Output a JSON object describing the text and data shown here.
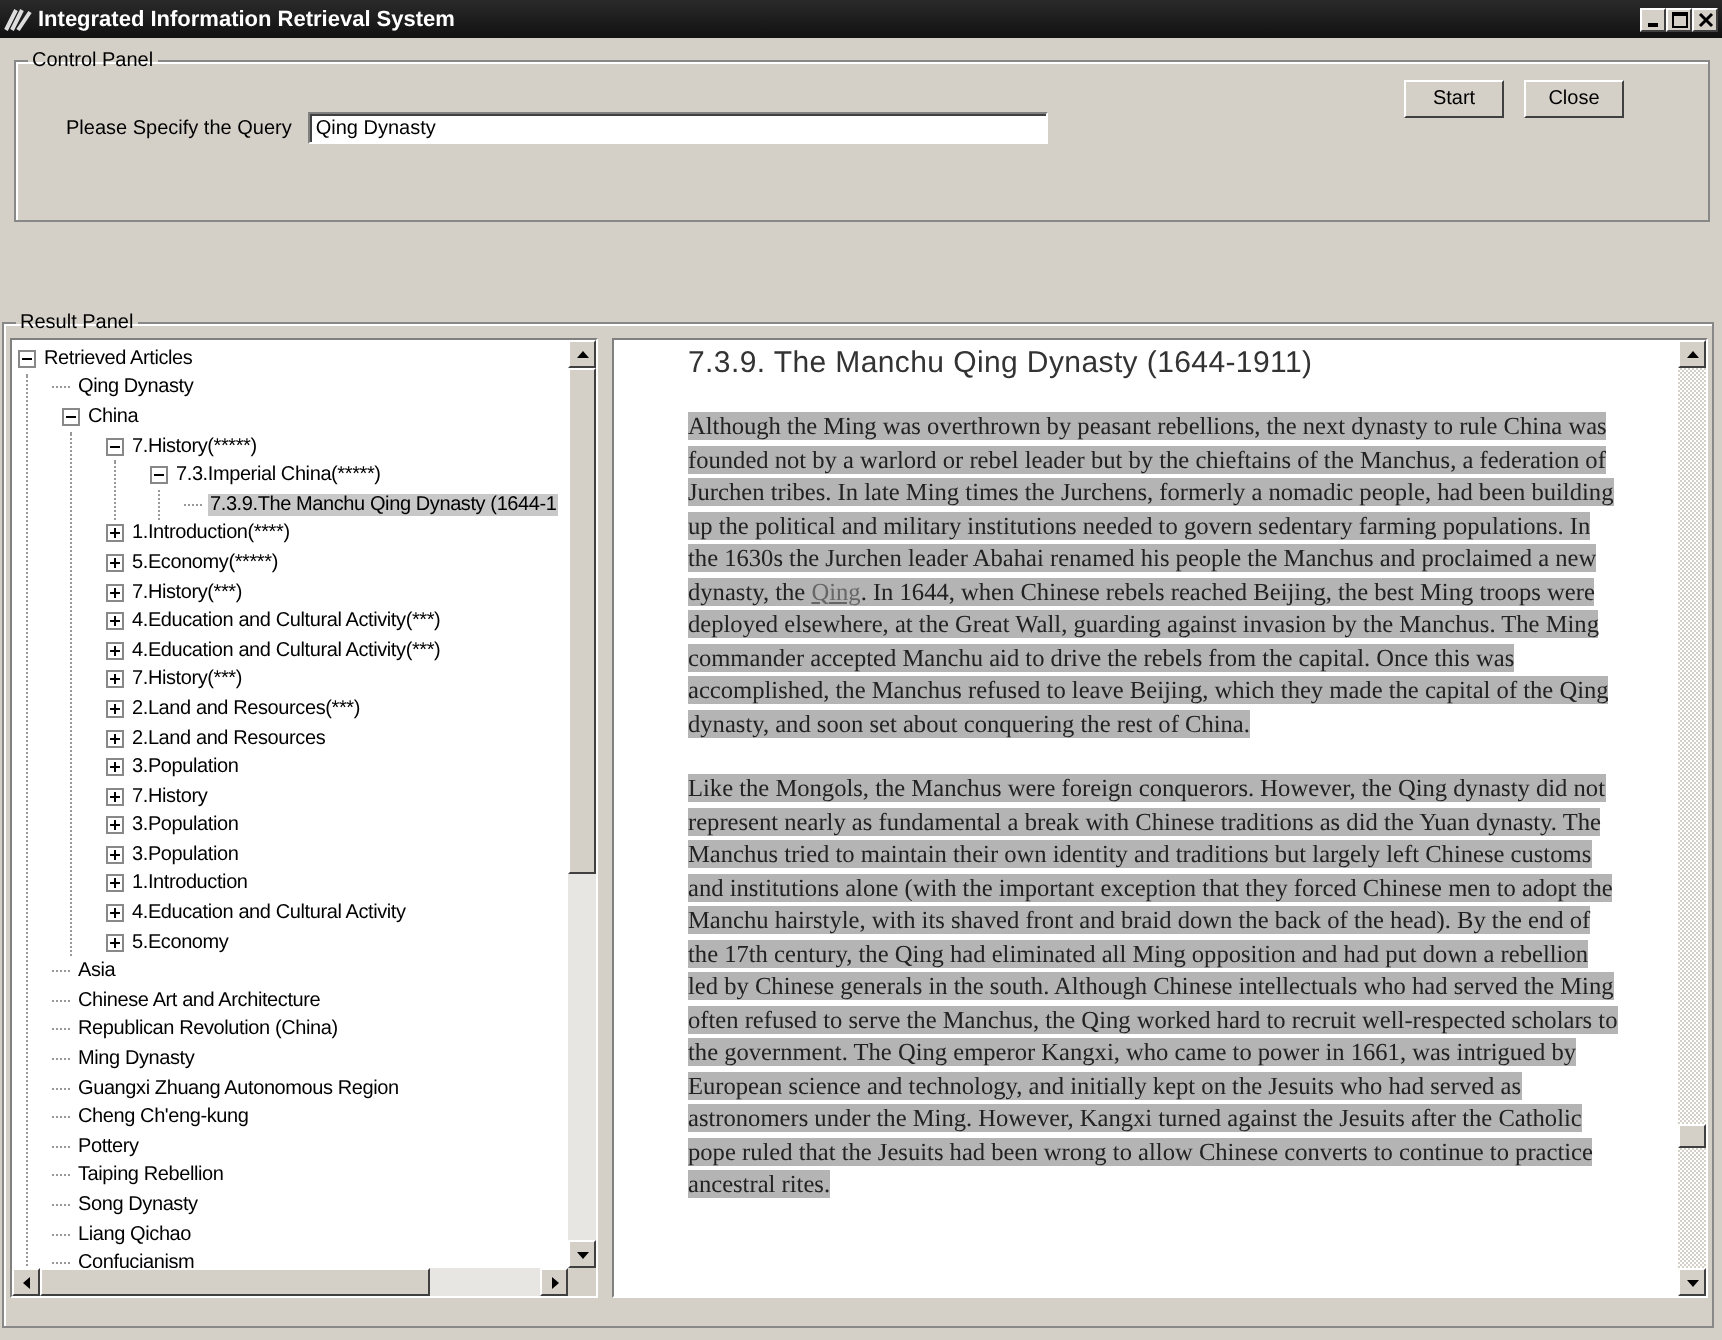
{
  "window": {
    "title": "Integrated Information Retrieval System"
  },
  "control_panel": {
    "title": "Control Panel",
    "query_label": "Please Specify the Query",
    "query_value": "Qing Dynasty",
    "buttons": [
      "Start",
      "Close"
    ]
  },
  "result_panel": {
    "title": "Result Panel",
    "tree": [
      {
        "kind": "node",
        "label": "Retrieved Articles",
        "expanded": true,
        "selected": false,
        "children": [
          {
            "kind": "leaf",
            "label": "Qing Dynasty",
            "selected": false
          },
          {
            "kind": "node",
            "label": "China",
            "expanded": true,
            "selected": false,
            "children": [
              {
                "kind": "node",
                "label": "7.History(*****)",
                "expanded": true,
                "selected": false,
                "children": [
                  {
                    "kind": "node",
                    "label": "7.3.Imperial China(*****)",
                    "expanded": true,
                    "selected": false,
                    "children": [
                      {
                        "kind": "leaf",
                        "label": "7.3.9.The Manchu Qing Dynasty (1644-1",
                        "selected": true
                      }
                    ]
                  }
                ]
              },
              {
                "kind": "node",
                "label": "1.Introduction(****)",
                "expanded": false,
                "selected": false
              },
              {
                "kind": "node",
                "label": "5.Economy(*****)",
                "expanded": false,
                "selected": false
              },
              {
                "kind": "node",
                "label": "7.History(***)",
                "expanded": false,
                "selected": false
              },
              {
                "kind": "node",
                "label": "4.Education and Cultural Activity(***)",
                "expanded": false,
                "selected": false
              },
              {
                "kind": "node",
                "label": "4.Education and Cultural Activity(***)",
                "expanded": false,
                "selected": false
              },
              {
                "kind": "node",
                "label": "7.History(***)",
                "expanded": false,
                "selected": false
              },
              {
                "kind": "node",
                "label": "2.Land and Resources(***)",
                "expanded": false,
                "selected": false
              },
              {
                "kind": "node",
                "label": "2.Land and Resources",
                "expanded": false,
                "selected": false
              },
              {
                "kind": "node",
                "label": "3.Population",
                "expanded": false,
                "selected": false
              },
              {
                "kind": "node",
                "label": "7.History",
                "expanded": false,
                "selected": false
              },
              {
                "kind": "node",
                "label": "3.Population",
                "expanded": false,
                "selected": false
              },
              {
                "kind": "node",
                "label": "3.Population",
                "expanded": false,
                "selected": false
              },
              {
                "kind": "node",
                "label": "1.Introduction",
                "expanded": false,
                "selected": false
              },
              {
                "kind": "node",
                "label": "4.Education and Cultural Activity",
                "expanded": false,
                "selected": false
              },
              {
                "kind": "node",
                "label": "5.Economy",
                "expanded": false,
                "selected": false
              }
            ]
          },
          {
            "kind": "leaf",
            "label": "Asia",
            "selected": false
          },
          {
            "kind": "leaf",
            "label": "Chinese Art and Architecture",
            "selected": false
          },
          {
            "kind": "leaf",
            "label": "Republican Revolution (China)",
            "selected": false
          },
          {
            "kind": "leaf",
            "label": "Ming Dynasty",
            "selected": false
          },
          {
            "kind": "leaf",
            "label": "Guangxi Zhuang Autonomous Region",
            "selected": false
          },
          {
            "kind": "leaf",
            "label": "Cheng Ch'eng-kung",
            "selected": false
          },
          {
            "kind": "leaf",
            "label": "Pottery",
            "selected": false
          },
          {
            "kind": "leaf",
            "label": "Taiping Rebellion",
            "selected": false
          },
          {
            "kind": "leaf",
            "label": "Song Dynasty",
            "selected": false
          },
          {
            "kind": "leaf",
            "label": "Liang Qichao",
            "selected": false
          },
          {
            "kind": "leaf",
            "label": "Confucianism",
            "selected": false
          }
        ]
      }
    ],
    "article": {
      "heading": "7.3.9. The Manchu Qing Dynasty (1644-1911)",
      "paragraphs": [
        [
          {
            "kind": "text",
            "text": "Although the Ming was overthrown by peasant rebellions, the next dynasty to rule China was founded not by a warlord or rebel leader but by the chieftains of the Manchus, a federation of Jurchen tribes. In late Ming times the Jurchens, formerly a nomadic people, had been building up the political and military institutions needed to govern sedentary farming populations. In the 1630s the Jurchen leader Abahai renamed his people the Manchus and proclaimed a new dynasty, the "
          },
          {
            "kind": "link",
            "text": "Qing"
          },
          {
            "kind": "text",
            "text": ". In 1644, when Chinese rebels reached Beijing, the best Ming troops were deployed elsewhere, at the Great Wall, guarding against invasion by the Manchus. The Ming commander accepted Manchu aid to drive the rebels from the capital. Once this was accomplished, the Manchus refused to leave Beijing, which they made the capital of the Qing dynasty, and soon set about conquering the rest of China."
          }
        ],
        [
          {
            "kind": "text",
            "text": "Like the Mongols, the Manchus were foreign conquerors. However, the Qing dynasty did not represent nearly as fundamental a break with Chinese traditions as did the Yuan dynasty. The Manchus tried to maintain their own identity and traditions but largely left Chinese customs and institutions alone (with the important exception that they forced Chinese men to adopt the Manchu hairstyle, with its shaved front and braid down the back of the head). By the end of the 17th century, the Qing had eliminated all Ming opposition and had put down a rebellion led by Chinese generals in the south. Although Chinese intellectuals who had served the Ming often refused to serve the Manchus, the Qing worked hard to recruit well-respected scholars to the government. The Qing emperor Kangxi, who came to power in 1661, was intrigued by European science and technology, and initially kept on the Jesuits who had served as astronomers under the Ming. However, Kangxi turned against the Jesuits after the Catholic pope ruled that the Jesuits had been wrong to allow Chinese converts to continue to practice ancestral rites."
          }
        ]
      ]
    }
  }
}
